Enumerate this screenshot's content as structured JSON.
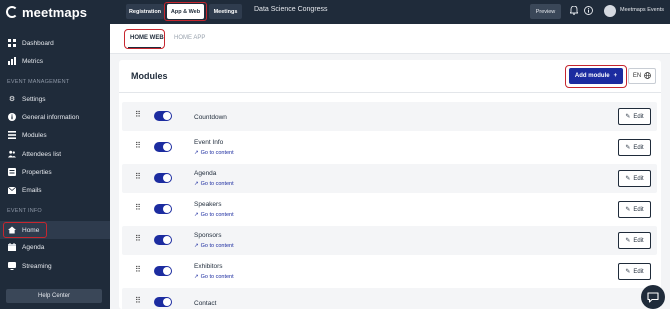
{
  "brand": {
    "name": "meetmaps"
  },
  "sidebar": {
    "items": [
      {
        "label": "Dashboard",
        "icon": "dashboard-icon"
      },
      {
        "label": "Metrics",
        "icon": "metrics-icon"
      }
    ],
    "section_event_management": "EVENT MANAGEMENT",
    "management_items": [
      {
        "label": "Settings",
        "icon": "gear-icon"
      },
      {
        "label": "General information",
        "icon": "info-icon"
      },
      {
        "label": "Modules",
        "icon": "modules-icon"
      },
      {
        "label": "Attendees list",
        "icon": "people-icon"
      },
      {
        "label": "Properties",
        "icon": "properties-icon"
      },
      {
        "label": "Emails",
        "icon": "mail-icon"
      }
    ],
    "section_event_info": "EVENT INFO",
    "info_items": [
      {
        "label": "Home",
        "icon": "home-icon"
      },
      {
        "label": "Agenda",
        "icon": "calendar-icon"
      },
      {
        "label": "Streaming",
        "icon": "streaming-icon"
      }
    ],
    "help_label": "Help Center"
  },
  "topbar": {
    "tabs": [
      {
        "label": "Registration"
      },
      {
        "label": "App & Web"
      },
      {
        "label": "Meetings"
      }
    ],
    "event_title": "Data Science Congress",
    "preview_label": "Preview",
    "user_name": "Meetmaps Events"
  },
  "subtabs": {
    "web": "HOME WEB",
    "app": "HOME APP"
  },
  "panel": {
    "title": "Modules",
    "add_label": "Add module",
    "lang_label": "EN",
    "goto_label": "Go to content",
    "edit_label": "Edit",
    "modules": [
      {
        "name": "Countdown",
        "has_goto": false
      },
      {
        "name": "Event Info",
        "has_goto": true
      },
      {
        "name": "Agenda",
        "has_goto": true
      },
      {
        "name": "Speakers",
        "has_goto": true
      },
      {
        "name": "Sponsors",
        "has_goto": true
      },
      {
        "name": "Exhibitors",
        "has_goto": true
      },
      {
        "name": "Contact",
        "has_goto": false
      }
    ]
  },
  "colors": {
    "sidebar_bg": "#1f2b3a",
    "accent": "#1c2ca0",
    "highlight": "#c6262e"
  }
}
